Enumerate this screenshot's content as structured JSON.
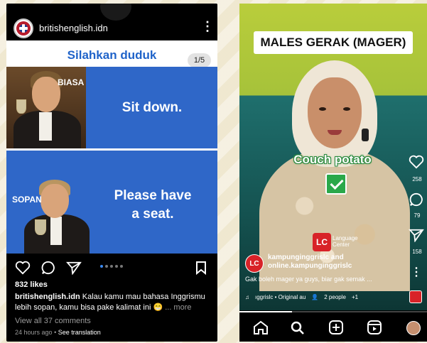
{
  "left_post": {
    "username": "britishenglish.idn",
    "more_icon": "more-vert-icon",
    "slide_title": "Silahkan duduk",
    "slide_counter": "1/5",
    "panel1": {
      "tag": "BIASA",
      "phrase": "Sit down."
    },
    "panel2": {
      "tag": "SOPAN",
      "phrase_line1": "Please have",
      "phrase_line2": "a seat."
    },
    "likes": "832 likes",
    "caption_user": "britishenglish.idn",
    "caption_text": "Kalau kamu mau bahasa Inggrismu lebih sopan, kamu bisa pake kalimat ini 😁",
    "caption_more": "... more",
    "comments": "View all 37 comments",
    "time": "24 hours ago",
    "translation": "See translation",
    "dot_count": 5,
    "active_dot": 0
  },
  "right_reel": {
    "banner": "MALES GERAK (MAGER)",
    "overlay_phrase": "Couch potato",
    "logo_letters": "LC",
    "logo_text_line1": "Language",
    "logo_text_line2": "Center",
    "author_line1": "kampunginggrislc and",
    "author_line2": "online.kampunginggrislc",
    "description": "Gak boleh mager ya guys, biar gak semak ...",
    "audio": "ıggrislc • Original au",
    "people": "2 people",
    "plus": "+1",
    "likes_count": "258",
    "comments_count": "79",
    "shares_count": "158",
    "progress": 0.28
  },
  "colors": {
    "accent_blue": "#2f67c8",
    "title_blue": "#1f63c9",
    "brand_red": "#d82228",
    "check_green": "#2aa84a"
  }
}
